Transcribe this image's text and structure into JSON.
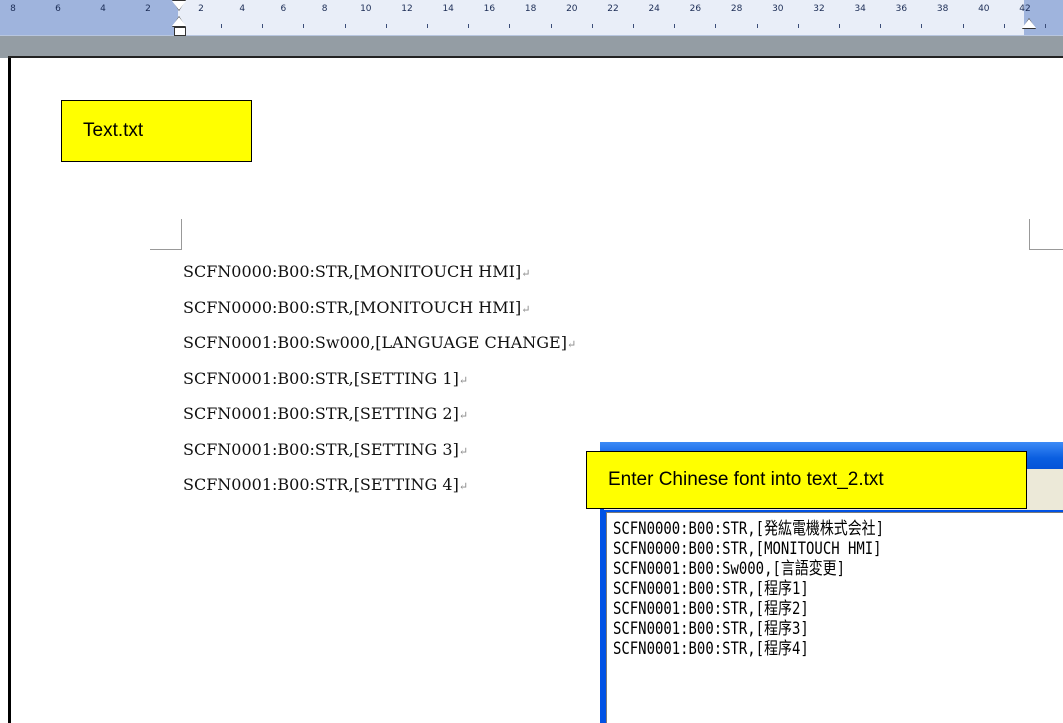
{
  "ruler": {
    "left_numbers": [
      "8",
      "6",
      "4",
      "2"
    ],
    "right_numbers": [
      "2",
      "4",
      "6",
      "8",
      "10",
      "12",
      "14",
      "16",
      "18",
      "20",
      "22",
      "24",
      "26",
      "28",
      "30",
      "32",
      "34",
      "36",
      "38",
      "40",
      "42"
    ]
  },
  "callouts": {
    "top_label": "Text.txt",
    "bottom_label": "Enter Chinese font into text_2.txt"
  },
  "document": {
    "paragraph_mark": "↵",
    "lines": [
      "SCFN0000:B00:STR,[MONITOUCH HMI]",
      "SCFN0000:B00:STR,[MONITOUCH HMI]",
      "SCFN0001:B00:Sw000,[LANGUAGE CHANGE]",
      "SCFN0001:B00:STR,[SETTING 1]",
      "SCFN0001:B00:STR,[SETTING 2]",
      "SCFN0001:B00:STR,[SETTING 3]",
      "SCFN0001:B00:STR,[SETTING 4]"
    ]
  },
  "notepad": {
    "lines": [
      "SCFN0000:B00:STR,[発紘電機株式会社]",
      "SCFN0000:B00:STR,[MONITOUCH HMI]",
      "SCFN0001:B00:Sw000,[言語変更]",
      "SCFN0001:B00:STR,[程序1]",
      "SCFN0001:B00:STR,[程序2]",
      "SCFN0001:B00:STR,[程序3]",
      "SCFN0001:B00:STR,[程序4]"
    ]
  },
  "colors": {
    "callout": "#ffff00",
    "ruler_margin": "#9fb4dd",
    "window_blue": "#0052e5"
  }
}
